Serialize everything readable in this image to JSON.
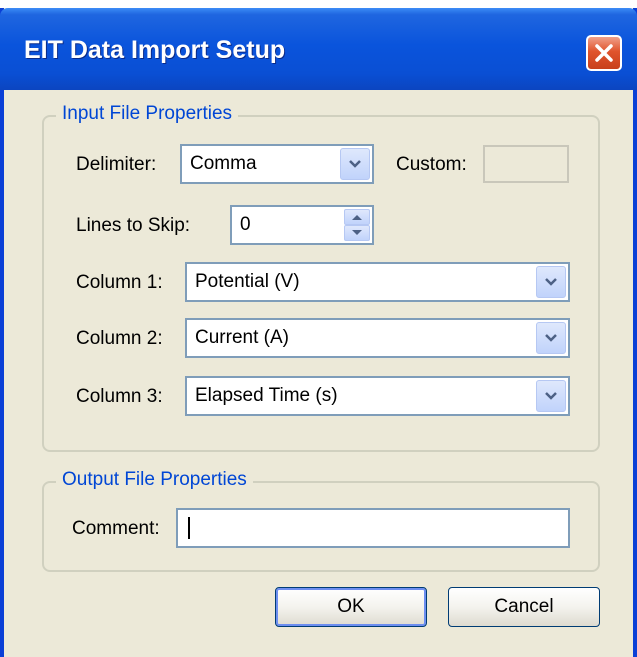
{
  "window": {
    "title": "EIT Data Import Setup"
  },
  "input_group": {
    "legend": "Input File Properties",
    "delimiter": {
      "label": "Delimiter:",
      "value": "Comma"
    },
    "custom": {
      "label": "Custom:",
      "value": ""
    },
    "lines_to_skip": {
      "label": "Lines to Skip:",
      "value": "0"
    },
    "columns": [
      {
        "label": "Column 1:",
        "value": "Potential (V)"
      },
      {
        "label": "Column 2:",
        "value": "Current (A)"
      },
      {
        "label": "Column 3:",
        "value": "Elapsed Time (s)"
      }
    ]
  },
  "output_group": {
    "legend": "Output File Properties",
    "comment": {
      "label": "Comment:",
      "value": ""
    }
  },
  "buttons": {
    "ok": "OK",
    "cancel": "Cancel"
  },
  "icons": {
    "close": "close-icon",
    "dropdown": "chevron-down-icon",
    "spin_up": "spin-up-icon",
    "spin_down": "spin-down-icon"
  },
  "colors": {
    "titlebar": "#0a54dc",
    "window_bg": "#ece9d8",
    "legend_text": "#0046d5",
    "close_button": "#e0542c"
  }
}
